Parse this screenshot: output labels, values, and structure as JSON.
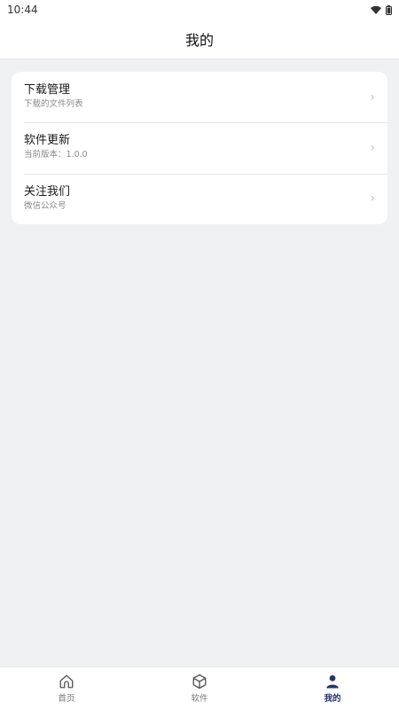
{
  "status_bar": {
    "time": "10:44"
  },
  "header": {
    "title": "我的"
  },
  "menu": [
    {
      "title": "下载管理",
      "subtitle": "下载的文件列表"
    },
    {
      "title": "软件更新",
      "subtitle": "当前版本：1.0.0"
    },
    {
      "title": "关注我们",
      "subtitle": "微信公众号"
    }
  ],
  "tabbar": {
    "tabs": [
      {
        "label": "首页",
        "icon": "home-icon"
      },
      {
        "label": "软件",
        "icon": "box-icon"
      },
      {
        "label": "我的",
        "icon": "user-icon",
        "active": true
      }
    ]
  },
  "colors": {
    "accent": "#28336f",
    "background": "#f0f1f3"
  }
}
